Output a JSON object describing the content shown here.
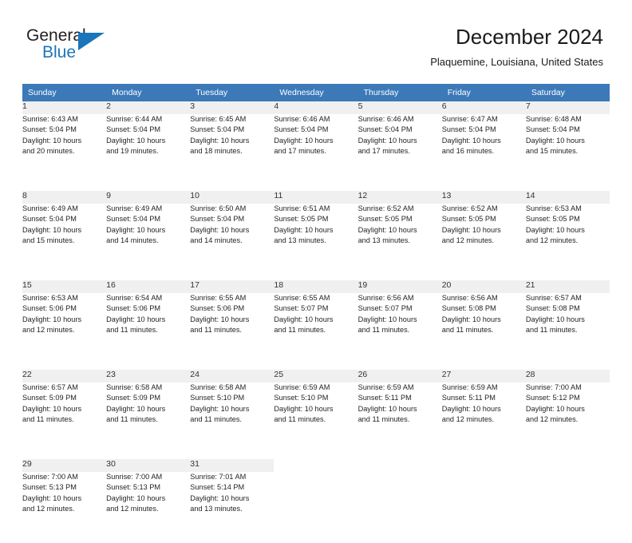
{
  "brand": {
    "name_part1": "General",
    "name_part2": "Blue",
    "color_dark": "#231f20",
    "color_blue": "#1b75bb"
  },
  "header": {
    "month_title": "December 2024",
    "location": "Plaquemine, Louisiana, United States"
  },
  "theme": {
    "header_row_bg": "#3c79b8",
    "daynum_bg": "#f0f0f0",
    "cell_border": "#d9d9d9",
    "text": "#231f20"
  },
  "weekday_headers": [
    "Sunday",
    "Monday",
    "Tuesday",
    "Wednesday",
    "Thursday",
    "Friday",
    "Saturday"
  ],
  "weeks": [
    {
      "days": [
        {
          "num": "1",
          "sunrise": "Sunrise: 6:43 AM",
          "sunset": "Sunset: 5:04 PM",
          "daylight1": "Daylight: 10 hours",
          "daylight2": "and 20 minutes."
        },
        {
          "num": "2",
          "sunrise": "Sunrise: 6:44 AM",
          "sunset": "Sunset: 5:04 PM",
          "daylight1": "Daylight: 10 hours",
          "daylight2": "and 19 minutes."
        },
        {
          "num": "3",
          "sunrise": "Sunrise: 6:45 AM",
          "sunset": "Sunset: 5:04 PM",
          "daylight1": "Daylight: 10 hours",
          "daylight2": "and 18 minutes."
        },
        {
          "num": "4",
          "sunrise": "Sunrise: 6:46 AM",
          "sunset": "Sunset: 5:04 PM",
          "daylight1": "Daylight: 10 hours",
          "daylight2": "and 17 minutes."
        },
        {
          "num": "5",
          "sunrise": "Sunrise: 6:46 AM",
          "sunset": "Sunset: 5:04 PM",
          "daylight1": "Daylight: 10 hours",
          "daylight2": "and 17 minutes."
        },
        {
          "num": "6",
          "sunrise": "Sunrise: 6:47 AM",
          "sunset": "Sunset: 5:04 PM",
          "daylight1": "Daylight: 10 hours",
          "daylight2": "and 16 minutes."
        },
        {
          "num": "7",
          "sunrise": "Sunrise: 6:48 AM",
          "sunset": "Sunset: 5:04 PM",
          "daylight1": "Daylight: 10 hours",
          "daylight2": "and 15 minutes."
        }
      ]
    },
    {
      "days": [
        {
          "num": "8",
          "sunrise": "Sunrise: 6:49 AM",
          "sunset": "Sunset: 5:04 PM",
          "daylight1": "Daylight: 10 hours",
          "daylight2": "and 15 minutes."
        },
        {
          "num": "9",
          "sunrise": "Sunrise: 6:49 AM",
          "sunset": "Sunset: 5:04 PM",
          "daylight1": "Daylight: 10 hours",
          "daylight2": "and 14 minutes."
        },
        {
          "num": "10",
          "sunrise": "Sunrise: 6:50 AM",
          "sunset": "Sunset: 5:04 PM",
          "daylight1": "Daylight: 10 hours",
          "daylight2": "and 14 minutes."
        },
        {
          "num": "11",
          "sunrise": "Sunrise: 6:51 AM",
          "sunset": "Sunset: 5:05 PM",
          "daylight1": "Daylight: 10 hours",
          "daylight2": "and 13 minutes."
        },
        {
          "num": "12",
          "sunrise": "Sunrise: 6:52 AM",
          "sunset": "Sunset: 5:05 PM",
          "daylight1": "Daylight: 10 hours",
          "daylight2": "and 13 minutes."
        },
        {
          "num": "13",
          "sunrise": "Sunrise: 6:52 AM",
          "sunset": "Sunset: 5:05 PM",
          "daylight1": "Daylight: 10 hours",
          "daylight2": "and 12 minutes."
        },
        {
          "num": "14",
          "sunrise": "Sunrise: 6:53 AM",
          "sunset": "Sunset: 5:05 PM",
          "daylight1": "Daylight: 10 hours",
          "daylight2": "and 12 minutes."
        }
      ]
    },
    {
      "days": [
        {
          "num": "15",
          "sunrise": "Sunrise: 6:53 AM",
          "sunset": "Sunset: 5:06 PM",
          "daylight1": "Daylight: 10 hours",
          "daylight2": "and 12 minutes."
        },
        {
          "num": "16",
          "sunrise": "Sunrise: 6:54 AM",
          "sunset": "Sunset: 5:06 PM",
          "daylight1": "Daylight: 10 hours",
          "daylight2": "and 11 minutes."
        },
        {
          "num": "17",
          "sunrise": "Sunrise: 6:55 AM",
          "sunset": "Sunset: 5:06 PM",
          "daylight1": "Daylight: 10 hours",
          "daylight2": "and 11 minutes."
        },
        {
          "num": "18",
          "sunrise": "Sunrise: 6:55 AM",
          "sunset": "Sunset: 5:07 PM",
          "daylight1": "Daylight: 10 hours",
          "daylight2": "and 11 minutes."
        },
        {
          "num": "19",
          "sunrise": "Sunrise: 6:56 AM",
          "sunset": "Sunset: 5:07 PM",
          "daylight1": "Daylight: 10 hours",
          "daylight2": "and 11 minutes."
        },
        {
          "num": "20",
          "sunrise": "Sunrise: 6:56 AM",
          "sunset": "Sunset: 5:08 PM",
          "daylight1": "Daylight: 10 hours",
          "daylight2": "and 11 minutes."
        },
        {
          "num": "21",
          "sunrise": "Sunrise: 6:57 AM",
          "sunset": "Sunset: 5:08 PM",
          "daylight1": "Daylight: 10 hours",
          "daylight2": "and 11 minutes."
        }
      ]
    },
    {
      "days": [
        {
          "num": "22",
          "sunrise": "Sunrise: 6:57 AM",
          "sunset": "Sunset: 5:09 PM",
          "daylight1": "Daylight: 10 hours",
          "daylight2": "and 11 minutes."
        },
        {
          "num": "23",
          "sunrise": "Sunrise: 6:58 AM",
          "sunset": "Sunset: 5:09 PM",
          "daylight1": "Daylight: 10 hours",
          "daylight2": "and 11 minutes."
        },
        {
          "num": "24",
          "sunrise": "Sunrise: 6:58 AM",
          "sunset": "Sunset: 5:10 PM",
          "daylight1": "Daylight: 10 hours",
          "daylight2": "and 11 minutes."
        },
        {
          "num": "25",
          "sunrise": "Sunrise: 6:59 AM",
          "sunset": "Sunset: 5:10 PM",
          "daylight1": "Daylight: 10 hours",
          "daylight2": "and 11 minutes."
        },
        {
          "num": "26",
          "sunrise": "Sunrise: 6:59 AM",
          "sunset": "Sunset: 5:11 PM",
          "daylight1": "Daylight: 10 hours",
          "daylight2": "and 11 minutes."
        },
        {
          "num": "27",
          "sunrise": "Sunrise: 6:59 AM",
          "sunset": "Sunset: 5:11 PM",
          "daylight1": "Daylight: 10 hours",
          "daylight2": "and 12 minutes."
        },
        {
          "num": "28",
          "sunrise": "Sunrise: 7:00 AM",
          "sunset": "Sunset: 5:12 PM",
          "daylight1": "Daylight: 10 hours",
          "daylight2": "and 12 minutes."
        }
      ]
    },
    {
      "days": [
        {
          "num": "29",
          "sunrise": "Sunrise: 7:00 AM",
          "sunset": "Sunset: 5:13 PM",
          "daylight1": "Daylight: 10 hours",
          "daylight2": "and 12 minutes."
        },
        {
          "num": "30",
          "sunrise": "Sunrise: 7:00 AM",
          "sunset": "Sunset: 5:13 PM",
          "daylight1": "Daylight: 10 hours",
          "daylight2": "and 12 minutes."
        },
        {
          "num": "31",
          "sunrise": "Sunrise: 7:01 AM",
          "sunset": "Sunset: 5:14 PM",
          "daylight1": "Daylight: 10 hours",
          "daylight2": "and 13 minutes."
        },
        {
          "num": "",
          "sunrise": "",
          "sunset": "",
          "daylight1": "",
          "daylight2": ""
        },
        {
          "num": "",
          "sunrise": "",
          "sunset": "",
          "daylight1": "",
          "daylight2": ""
        },
        {
          "num": "",
          "sunrise": "",
          "sunset": "",
          "daylight1": "",
          "daylight2": ""
        },
        {
          "num": "",
          "sunrise": "",
          "sunset": "",
          "daylight1": "",
          "daylight2": ""
        }
      ]
    }
  ]
}
